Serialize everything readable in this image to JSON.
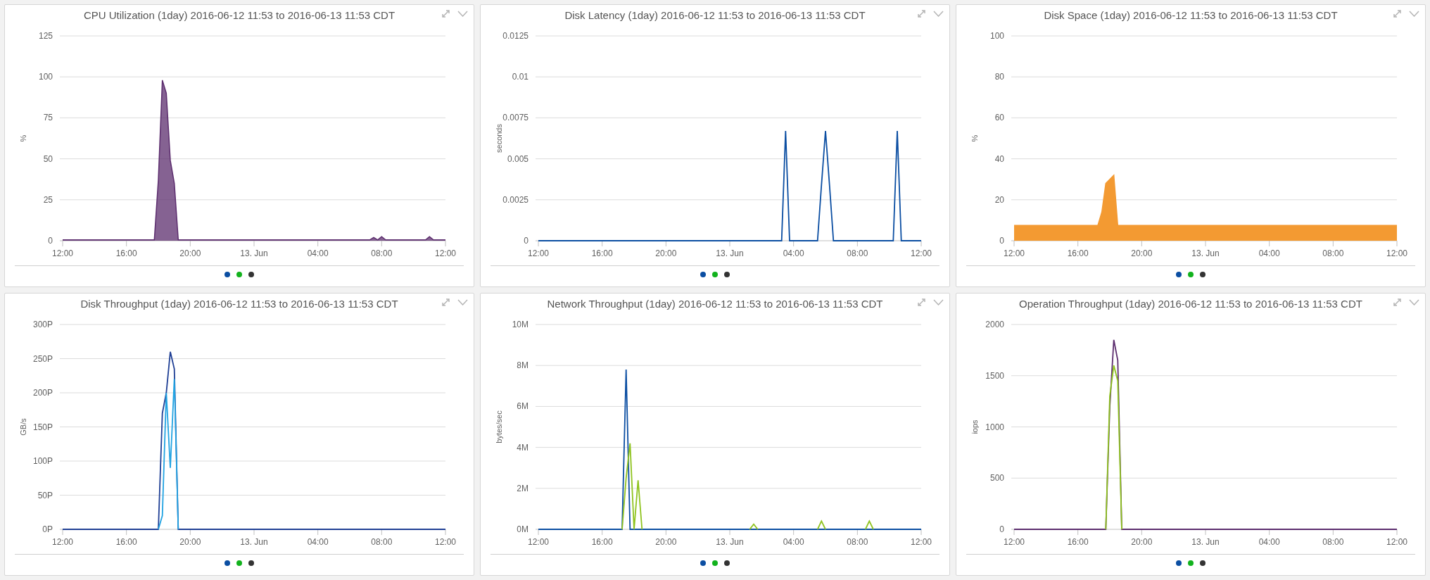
{
  "panels": [
    {
      "title": "CPU Utilization (1day) 2016-06-12 11:53 to 2016-06-13 11:53 CDT",
      "legend_dots": [
        {
          "color": "#0b4ea2"
        },
        {
          "color": "#12b21d"
        },
        {
          "color": "#333333"
        }
      ],
      "chart_data": {
        "type": "area",
        "ylabel": "%",
        "grid": true,
        "ylim": [
          0,
          125
        ],
        "yticks": [
          0,
          25,
          50,
          75,
          100,
          125
        ],
        "categories": [
          "12:00",
          null,
          null,
          null,
          null,
          null,
          null,
          null,
          null,
          null,
          null,
          null,
          null,
          null,
          null,
          null,
          "16:00",
          null,
          null,
          null,
          null,
          null,
          null,
          null,
          null,
          null,
          null,
          null,
          null,
          null,
          null,
          null,
          "20:00",
          null,
          null,
          null,
          null,
          null,
          null,
          null,
          null,
          null,
          null,
          null,
          null,
          null,
          null,
          null,
          "13. Jun",
          null,
          null,
          null,
          null,
          null,
          null,
          null,
          null,
          null,
          null,
          null,
          null,
          null,
          null,
          null,
          "04:00",
          null,
          null,
          null,
          null,
          null,
          null,
          null,
          null,
          null,
          null,
          null,
          null,
          null,
          null,
          null,
          "08:00",
          null,
          null,
          null,
          null,
          null,
          null,
          null,
          null,
          null,
          null,
          null,
          null,
          null,
          null,
          null,
          "12:00"
        ],
        "series": [
          {
            "color": "#5c2d6e",
            "values": [
              0.5,
              0.5,
              0.5,
              0.5,
              0.5,
              0.5,
              0.5,
              0.5,
              0.5,
              0.5,
              0.5,
              0.5,
              0.5,
              0.5,
              0.5,
              0.5,
              0.5,
              0.5,
              0.5,
              0.5,
              0.5,
              0.5,
              0.5,
              0.5,
              37,
              98,
              90,
              49,
              35,
              0.5,
              0.5,
              0.5,
              0.5,
              0.5,
              0.5,
              0.5,
              0.5,
              0.5,
              0.5,
              0.5,
              0.5,
              0.5,
              0.5,
              0.5,
              0.5,
              0.5,
              0.5,
              0.5,
              0.5,
              0.5,
              0.5,
              0.5,
              0.5,
              0.5,
              0.5,
              0.5,
              0.5,
              0.5,
              0.5,
              0.5,
              0.5,
              0.5,
              0.5,
              0.5,
              0.5,
              0.5,
              0.5,
              0.5,
              0.5,
              0.5,
              0.5,
              0.5,
              0.5,
              0.5,
              0.5,
              0.5,
              0.5,
              0.5,
              2,
              0.5,
              2.5,
              0.5,
              0.5,
              0.5,
              0.5,
              0.5,
              0.5,
              0.5,
              0.5,
              0.5,
              0.5,
              0.5,
              2.5,
              0.5,
              0.5,
              0.5,
              0.5
            ]
          }
        ]
      }
    },
    {
      "title": "Disk Latency (1day) 2016-06-12 11:53 to 2016-06-13 11:53 CDT",
      "legend_dots": [
        {
          "color": "#0b4ea2"
        },
        {
          "color": "#12b21d"
        },
        {
          "color": "#333333"
        }
      ],
      "chart_data": {
        "type": "line",
        "ylabel": "seconds",
        "grid": true,
        "ylim": [
          0,
          0.0125
        ],
        "yticks": [
          0,
          0.0025,
          0.005,
          0.0075,
          0.01,
          0.0125
        ],
        "categories": [
          "12:00",
          null,
          null,
          null,
          null,
          null,
          null,
          null,
          null,
          null,
          null,
          null,
          null,
          null,
          null,
          null,
          "16:00",
          null,
          null,
          null,
          null,
          null,
          null,
          null,
          null,
          null,
          null,
          null,
          null,
          null,
          null,
          null,
          "20:00",
          null,
          null,
          null,
          null,
          null,
          null,
          null,
          null,
          null,
          null,
          null,
          null,
          null,
          null,
          null,
          "13. Jun",
          null,
          null,
          null,
          null,
          null,
          null,
          null,
          null,
          null,
          null,
          null,
          null,
          null,
          null,
          null,
          "04:00",
          null,
          null,
          null,
          null,
          null,
          null,
          null,
          null,
          null,
          null,
          null,
          null,
          null,
          null,
          null,
          "08:00",
          null,
          null,
          null,
          null,
          null,
          null,
          null,
          null,
          null,
          null,
          null,
          null,
          null,
          null,
          null,
          "12:00"
        ],
        "series": [
          {
            "color": "#0b4ea2",
            "values": [
              0,
              0,
              0,
              0,
              0,
              0,
              0,
              0,
              0,
              0,
              0,
              0,
              0,
              0,
              0,
              0,
              0,
              0,
              0,
              0,
              0,
              0,
              0,
              0,
              0,
              0,
              0,
              0,
              0,
              0,
              0,
              0,
              0,
              0,
              0,
              0,
              0,
              0,
              0,
              0,
              0,
              0,
              0,
              0,
              0,
              0,
              0,
              0,
              0,
              0,
              0,
              0,
              0,
              0,
              0,
              0,
              0,
              0,
              0,
              0,
              0,
              0,
              0.0067,
              0,
              0,
              0,
              0,
              0,
              0,
              0,
              0,
              0.0034,
              0.0067,
              0.0034,
              0,
              0,
              0,
              0,
              0,
              0,
              0,
              0,
              0,
              0,
              0,
              0,
              0,
              0,
              0,
              0,
              0.0067,
              0,
              0,
              0,
              0,
              0,
              0
            ]
          }
        ]
      }
    },
    {
      "title": "Disk Space (1day) 2016-06-12 11:53 to 2016-06-13 11:53 CDT",
      "legend_dots": [
        {
          "color": "#0b4ea2"
        },
        {
          "color": "#12b21d"
        },
        {
          "color": "#333333"
        }
      ],
      "chart_data": {
        "type": "area",
        "ylabel": "%",
        "grid": true,
        "ylim": [
          0,
          100
        ],
        "yticks": [
          0,
          20,
          40,
          60,
          80,
          100
        ],
        "categories": [
          "12:00",
          null,
          null,
          null,
          null,
          null,
          null,
          null,
          null,
          null,
          null,
          null,
          null,
          null,
          null,
          null,
          "16:00",
          null,
          null,
          null,
          null,
          null,
          null,
          null,
          null,
          null,
          null,
          null,
          null,
          null,
          null,
          null,
          "20:00",
          null,
          null,
          null,
          null,
          null,
          null,
          null,
          null,
          null,
          null,
          null,
          null,
          null,
          null,
          null,
          "13. Jun",
          null,
          null,
          null,
          null,
          null,
          null,
          null,
          null,
          null,
          null,
          null,
          null,
          null,
          null,
          null,
          "04:00",
          null,
          null,
          null,
          null,
          null,
          null,
          null,
          null,
          null,
          null,
          null,
          null,
          null,
          null,
          null,
          "08:00",
          null,
          null,
          null,
          null,
          null,
          null,
          null,
          null,
          null,
          null,
          null,
          null,
          null,
          null,
          null,
          "12:00"
        ],
        "series": [
          {
            "color": "#f39a32",
            "values": [
              7.5,
              7.5,
              7.5,
              7.5,
              7.5,
              7.5,
              7.5,
              7.5,
              7.5,
              7.5,
              7.5,
              7.5,
              7.5,
              7.5,
              7.5,
              7.5,
              7.5,
              7.5,
              7.5,
              7.5,
              7.5,
              7.5,
              14,
              28,
              30,
              32,
              7.5,
              7.5,
              7.5,
              7.5,
              7.5,
              7.5,
              7.5,
              7.5,
              7.5,
              7.5,
              7.5,
              7.5,
              7.5,
              7.5,
              7.5,
              7.5,
              7.5,
              7.5,
              7.5,
              7.5,
              7.5,
              7.5,
              7.5,
              7.5,
              7.5,
              7.5,
              7.5,
              7.5,
              7.5,
              7.5,
              7.5,
              7.5,
              7.5,
              7.5,
              7.5,
              7.5,
              7.5,
              7.5,
              7.5,
              7.5,
              7.5,
              7.5,
              7.5,
              7.5,
              7.5,
              7.5,
              7.5,
              7.5,
              7.5,
              7.5,
              7.5,
              7.5,
              7.5,
              7.5,
              7.5,
              7.5,
              7.5,
              7.5,
              7.5,
              7.5,
              7.5,
              7.5,
              7.5,
              7.5,
              7.5,
              7.5,
              7.5,
              7.5,
              7.5,
              7.5,
              7.5
            ]
          }
        ]
      }
    },
    {
      "title": "Disk Throughput (1day) 2016-06-12 11:53 to 2016-06-13 11:53 CDT",
      "legend_dots": [
        {
          "color": "#0b4ea2"
        },
        {
          "color": "#12b21d"
        },
        {
          "color": "#333333"
        }
      ],
      "chart_data": {
        "type": "line",
        "ylabel": "GB/s",
        "grid": true,
        "ylim": [
          0,
          300
        ],
        "yticks": [
          {
            "value": 0,
            "label": "0P"
          },
          {
            "value": 50,
            "label": "50P"
          },
          {
            "value": 100,
            "label": "100P"
          },
          {
            "value": 150,
            "label": "150P"
          },
          {
            "value": 200,
            "label": "200P"
          },
          {
            "value": 250,
            "label": "250P"
          },
          {
            "value": 300,
            "label": "300P"
          }
        ],
        "categories": [
          "12:00",
          null,
          null,
          null,
          null,
          null,
          null,
          null,
          null,
          null,
          null,
          null,
          null,
          null,
          null,
          null,
          "16:00",
          null,
          null,
          null,
          null,
          null,
          null,
          null,
          null,
          null,
          null,
          null,
          null,
          null,
          null,
          null,
          "20:00",
          null,
          null,
          null,
          null,
          null,
          null,
          null,
          null,
          null,
          null,
          null,
          null,
          null,
          null,
          null,
          "13. Jun",
          null,
          null,
          null,
          null,
          null,
          null,
          null,
          null,
          null,
          null,
          null,
          null,
          null,
          null,
          null,
          "04:00",
          null,
          null,
          null,
          null,
          null,
          null,
          null,
          null,
          null,
          null,
          null,
          null,
          null,
          null,
          null,
          "08:00",
          null,
          null,
          null,
          null,
          null,
          null,
          null,
          null,
          null,
          null,
          null,
          null,
          null,
          null,
          null,
          "12:00"
        ],
        "series": [
          {
            "color": "#1f3f95",
            "values": [
              0,
              0,
              0,
              0,
              0,
              0,
              0,
              0,
              0,
              0,
              0,
              0,
              0,
              0,
              0,
              0,
              0,
              0,
              0,
              0,
              0,
              0,
              0,
              0,
              0,
              170,
              200,
              260,
              235,
              0,
              0,
              0,
              0,
              0,
              0,
              0,
              0,
              0,
              0,
              0,
              0,
              0,
              0,
              0,
              0,
              0,
              0,
              0,
              0,
              0,
              0,
              0,
              0,
              0,
              0,
              0,
              0,
              0,
              0,
              0,
              0,
              0,
              0,
              0,
              0,
              0,
              0,
              0,
              0,
              0,
              0,
              0,
              0,
              0,
              0,
              0,
              0,
              0,
              0,
              0,
              0,
              0,
              0,
              0,
              0,
              0,
              0,
              0,
              0,
              0,
              0,
              0,
              0,
              0,
              0,
              0,
              0
            ]
          },
          {
            "color": "#22a3e2",
            "values": [
              null,
              null,
              null,
              null,
              null,
              null,
              null,
              null,
              null,
              null,
              null,
              null,
              null,
              null,
              null,
              null,
              null,
              null,
              null,
              null,
              null,
              null,
              null,
              null,
              0,
              20,
              200,
              90,
              220,
              0,
              null,
              null,
              null,
              null,
              null,
              null,
              null,
              null,
              null,
              null,
              null,
              null,
              null,
              null,
              null,
              null,
              null,
              null,
              null,
              null,
              null,
              null,
              null,
              null,
              null,
              null,
              null,
              null,
              null,
              null,
              null,
              null,
              null,
              null,
              null,
              null,
              null,
              null,
              null,
              null,
              null,
              null,
              null,
              null,
              null,
              null,
              null,
              null,
              null,
              null,
              null,
              null,
              null,
              null,
              null,
              null,
              null,
              null,
              null,
              null,
              null,
              null,
              null,
              null,
              null,
              null,
              null
            ]
          }
        ]
      }
    },
    {
      "title": "Network Throughput (1day) 2016-06-12 11:53 to 2016-06-13 11:53 CDT",
      "legend_dots": [
        {
          "color": "#0b4ea2"
        },
        {
          "color": "#12b21d"
        },
        {
          "color": "#333333"
        }
      ],
      "chart_data": {
        "type": "line",
        "ylabel": "bytes/sec",
        "grid": true,
        "ylim": [
          0,
          10
        ],
        "yticks": [
          {
            "value": 0,
            "label": "0M"
          },
          {
            "value": 2,
            "label": "2M"
          },
          {
            "value": 4,
            "label": "4M"
          },
          {
            "value": 6,
            "label": "6M"
          },
          {
            "value": 8,
            "label": "8M"
          },
          {
            "value": 10,
            "label": "10M"
          }
        ],
        "categories": [
          "12:00",
          null,
          null,
          null,
          null,
          null,
          null,
          null,
          null,
          null,
          null,
          null,
          null,
          null,
          null,
          null,
          "16:00",
          null,
          null,
          null,
          null,
          null,
          null,
          null,
          null,
          null,
          null,
          null,
          null,
          null,
          null,
          null,
          "20:00",
          null,
          null,
          null,
          null,
          null,
          null,
          null,
          null,
          null,
          null,
          null,
          null,
          null,
          null,
          null,
          "13. Jun",
          null,
          null,
          null,
          null,
          null,
          null,
          null,
          null,
          null,
          null,
          null,
          null,
          null,
          null,
          null,
          "04:00",
          null,
          null,
          null,
          null,
          null,
          null,
          null,
          null,
          null,
          null,
          null,
          null,
          null,
          null,
          null,
          "08:00",
          null,
          null,
          null,
          null,
          null,
          null,
          null,
          null,
          null,
          null,
          null,
          null,
          null,
          null,
          null,
          "12:00"
        ],
        "series": [
          {
            "color": "#0b4ea2",
            "values": [
              0,
              0,
              0,
              0,
              0,
              0,
              0,
              0,
              0,
              0,
              0,
              0,
              0,
              0,
              0,
              0,
              0,
              0,
              0,
              0,
              0,
              0,
              7.8,
              0,
              0,
              0,
              0,
              0,
              0,
              0,
              0,
              0,
              0,
              0,
              0,
              0,
              0,
              0,
              0,
              0,
              0,
              0,
              0,
              0,
              0,
              0,
              0,
              0,
              0,
              0,
              0,
              0,
              0,
              0,
              0,
              0,
              0,
              0,
              0,
              0,
              0,
              0,
              0,
              0,
              0,
              0,
              0,
              0,
              0,
              0,
              0,
              0,
              0,
              0,
              0,
              0,
              0,
              0,
              0,
              0,
              0,
              0,
              0,
              0,
              0,
              0,
              0,
              0,
              0,
              0,
              0,
              0,
              0,
              0,
              0,
              0,
              0
            ]
          },
          {
            "color": "#8fc31f",
            "values": [
              null,
              null,
              null,
              null,
              null,
              null,
              null,
              null,
              null,
              null,
              null,
              null,
              null,
              null,
              null,
              null,
              null,
              null,
              null,
              null,
              null,
              0,
              2.5,
              4.2,
              0,
              2.4,
              0,
              null,
              null,
              null,
              null,
              null,
              null,
              null,
              null,
              null,
              null,
              null,
              null,
              null,
              null,
              null,
              null,
              null,
              null,
              null,
              null,
              null,
              null,
              null,
              null,
              null,
              null,
              0,
              0.25,
              0,
              null,
              null,
              null,
              null,
              null,
              null,
              null,
              null,
              null,
              null,
              null,
              null,
              null,
              null,
              0,
              0.4,
              0,
              null,
              null,
              null,
              null,
              null,
              null,
              null,
              null,
              null,
              0,
              0.4,
              0,
              null,
              null,
              null,
              null,
              null,
              null,
              null,
              null,
              null,
              null,
              null,
              null
            ]
          }
        ]
      }
    },
    {
      "title": "Operation Throughput (1day) 2016-06-12 11:53 to 2016-06-13 11:53 CDT",
      "legend_dots": [
        {
          "color": "#0b4ea2"
        },
        {
          "color": "#12b21d"
        },
        {
          "color": "#333333"
        }
      ],
      "chart_data": {
        "type": "line",
        "ylabel": "iops",
        "grid": true,
        "ylim": [
          0,
          2000
        ],
        "yticks": [
          0,
          500,
          1000,
          1500,
          2000
        ],
        "categories": [
          "12:00",
          null,
          null,
          null,
          null,
          null,
          null,
          null,
          null,
          null,
          null,
          null,
          null,
          null,
          null,
          null,
          "16:00",
          null,
          null,
          null,
          null,
          null,
          null,
          null,
          null,
          null,
          null,
          null,
          null,
          null,
          null,
          null,
          "20:00",
          null,
          null,
          null,
          null,
          null,
          null,
          null,
          null,
          null,
          null,
          null,
          null,
          null,
          null,
          null,
          "13. Jun",
          null,
          null,
          null,
          null,
          null,
          null,
          null,
          null,
          null,
          null,
          null,
          null,
          null,
          null,
          null,
          "04:00",
          null,
          null,
          null,
          null,
          null,
          null,
          null,
          null,
          null,
          null,
          null,
          null,
          null,
          null,
          null,
          "08:00",
          null,
          null,
          null,
          null,
          null,
          null,
          null,
          null,
          null,
          null,
          null,
          null,
          null,
          null,
          null,
          "12:00"
        ],
        "series": [
          {
            "color": "#5c2d6e",
            "values": [
              0,
              0,
              0,
              0,
              0,
              0,
              0,
              0,
              0,
              0,
              0,
              0,
              0,
              0,
              0,
              0,
              0,
              0,
              0,
              0,
              0,
              0,
              0,
              0,
              1200,
              1850,
              1650,
              0,
              0,
              0,
              0,
              0,
              0,
              0,
              0,
              0,
              0,
              0,
              0,
              0,
              0,
              0,
              0,
              0,
              0,
              0,
              0,
              0,
              0,
              0,
              0,
              0,
              0,
              0,
              0,
              0,
              0,
              0,
              0,
              0,
              0,
              0,
              0,
              0,
              0,
              0,
              0,
              0,
              0,
              0,
              0,
              0,
              0,
              0,
              0,
              0,
              0,
              0,
              0,
              0,
              0,
              0,
              0,
              0,
              0,
              0,
              0,
              0,
              0,
              0,
              0,
              0,
              0,
              0,
              0,
              0,
              0
            ]
          },
          {
            "color": "#8fc31f",
            "values": [
              null,
              null,
              null,
              null,
              null,
              null,
              null,
              null,
              null,
              null,
              null,
              null,
              null,
              null,
              null,
              null,
              null,
              null,
              null,
              null,
              null,
              null,
              null,
              0,
              1300,
              1600,
              1450,
              0,
              null,
              null,
              null,
              null,
              null,
              null,
              null,
              null,
              null,
              null,
              null,
              null,
              null,
              null,
              null,
              null,
              null,
              null,
              null,
              null,
              null,
              null,
              null,
              null,
              null,
              null,
              null,
              null,
              null,
              null,
              null,
              null,
              null,
              null,
              null,
              null,
              null,
              null,
              null,
              null,
              null,
              null,
              null,
              null,
              null,
              null,
              null,
              null,
              null,
              null,
              null,
              null,
              null,
              null,
              null,
              null,
              null,
              null,
              null,
              null,
              null,
              null,
              null,
              null,
              null,
              null,
              null,
              null,
              null
            ]
          }
        ]
      }
    }
  ]
}
